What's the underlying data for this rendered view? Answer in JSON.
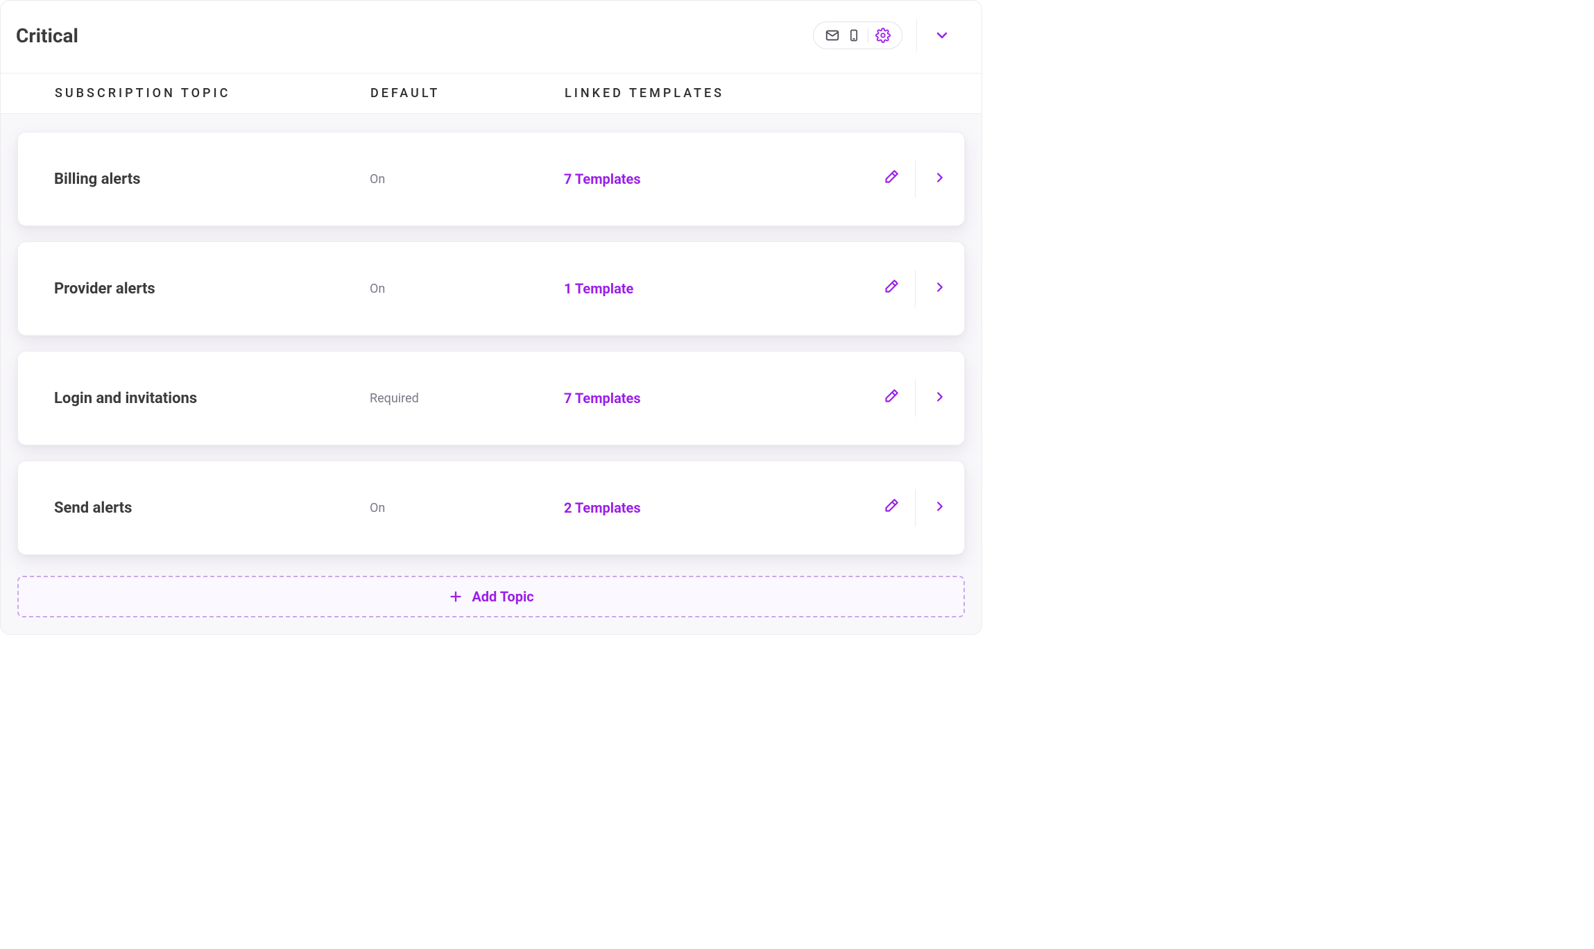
{
  "panel": {
    "title": "Critical"
  },
  "columns": {
    "topic": "SUBSCRIPTION TOPIC",
    "default": "DEFAULT",
    "templates": "LINKED TEMPLATES"
  },
  "topics": [
    {
      "name": "Billing alerts",
      "default": "On",
      "templates": "7 Templates"
    },
    {
      "name": "Provider alerts",
      "default": "On",
      "templates": "1 Template"
    },
    {
      "name": "Login and invitations",
      "default": "Required",
      "templates": "7 Templates"
    },
    {
      "name": "Send alerts",
      "default": "On",
      "templates": "2 Templates"
    }
  ],
  "actions": {
    "add_topic": "Add Topic"
  },
  "colors": {
    "accent": "#9b1fe8",
    "muted": "#7a7a88"
  }
}
